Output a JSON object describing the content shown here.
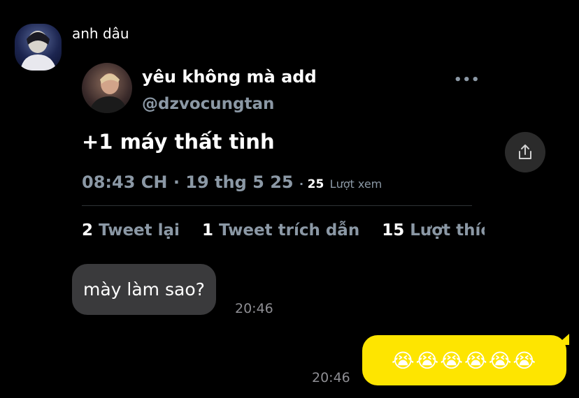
{
  "chat": {
    "sender_name": "anh dâu"
  },
  "tweet": {
    "display_name": "yêu không mà add",
    "handle": "@dzvocungtan",
    "more_icon": "•••",
    "text": "+1 máy thất tình",
    "time": "08:43 CH",
    "date": "19 thg 5 25",
    "views_count": "25",
    "views_label": "Lượt xem",
    "retweets_count": "2",
    "retweets_label": "Tweet lại",
    "quotes_count": "1",
    "quotes_label": "Tweet trích dẫn",
    "likes_count": "15",
    "likes_label": "Lượt thích"
  },
  "messages": {
    "incoming_text": "mày làm sao?",
    "incoming_time": "20:46",
    "outgoing_emojis": "😭😭😭😭😭😭",
    "outgoing_time": "20:46"
  },
  "icons": {
    "share": "share-icon",
    "more": "more-icon"
  },
  "colors": {
    "background": "#000000",
    "incoming_bubble": "#3a3a3c",
    "outgoing_bubble": "#fee500",
    "twitter_gray": "#8b98a5"
  }
}
